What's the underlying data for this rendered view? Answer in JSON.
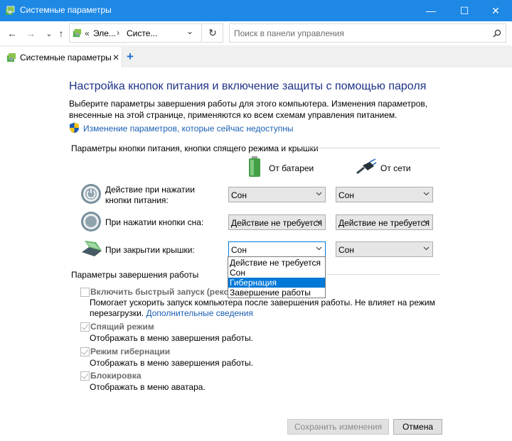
{
  "window": {
    "title": "Системные параметры",
    "minimize_glyph": "—",
    "maximize_glyph": "☐",
    "close_glyph": "✕"
  },
  "nav": {
    "back_glyph": "←",
    "forward_glyph": "→",
    "recent_glyph": "⌄",
    "up_glyph": "↑",
    "breadcrumb_sep": "«",
    "crumb1": "Эле...",
    "crumb_arrow": "›",
    "crumb2": "Систе...",
    "address_dropdown_glyph": "⌄",
    "refresh_glyph": "↻",
    "search_placeholder": "Поиск в панели управления",
    "search_icon": "search-icon"
  },
  "tab": {
    "label": "Системные параметры",
    "close_glyph": "✕",
    "new_tab_glyph": "+"
  },
  "page": {
    "heading": "Настройка кнопок питания и включение защиты с помощью пароля",
    "description": "Выберите параметры завершения работы для этого компьютера. Изменения параметров, внесенные на этой странице, применяются ко всем схемам управления питанием.",
    "admin_link": "Изменение параметров, которые сейчас недоступны",
    "section1_title": "Параметры кнопки питания, кнопки спящего режима и крышки",
    "col_battery": "От батареи",
    "col_ac": "От сети",
    "rows": [
      {
        "label": "Действие при нажатии кнопки питания:",
        "battery": "Сон",
        "ac": "Сон"
      },
      {
        "label": "При нажатии кнопки сна:",
        "battery": "Действие не требуется",
        "ac": "Действие не требуется"
      },
      {
        "label": "При закрытии крышки:",
        "battery": "Сон",
        "ac": "Сон"
      }
    ],
    "dropdown_options": [
      "Действие не требуется",
      "Сон",
      "Гибернация",
      "Завершение работы"
    ],
    "dropdown_selected_index": 2,
    "section2_title": "Параметры завершения работы",
    "options": [
      {
        "label": "Включить быстрый запуск (рекомен",
        "desc_line1": "Помогает ускорить запуск компьютера после завершения работы. Не влияет на режим",
        "desc_line2_prefix": "перезагрузки. ",
        "desc_link": "Дополнительные сведения",
        "checked": false
      },
      {
        "label": "Спящий режим",
        "desc": "Отображать в меню завершения работы.",
        "checked": true
      },
      {
        "label": "Режим гибернации",
        "desc": "Отображать в меню завершения работы.",
        "checked": true
      },
      {
        "label": "Блокировка",
        "desc": "Отображать в меню аватара.",
        "checked": true
      }
    ],
    "save_label": "Сохранить изменения",
    "cancel_label": "Отмена"
  },
  "colors": {
    "titlebar": "#1e88e5",
    "heading": "#1e3287",
    "link": "#1a5fb4",
    "selection": "#0078d7"
  }
}
